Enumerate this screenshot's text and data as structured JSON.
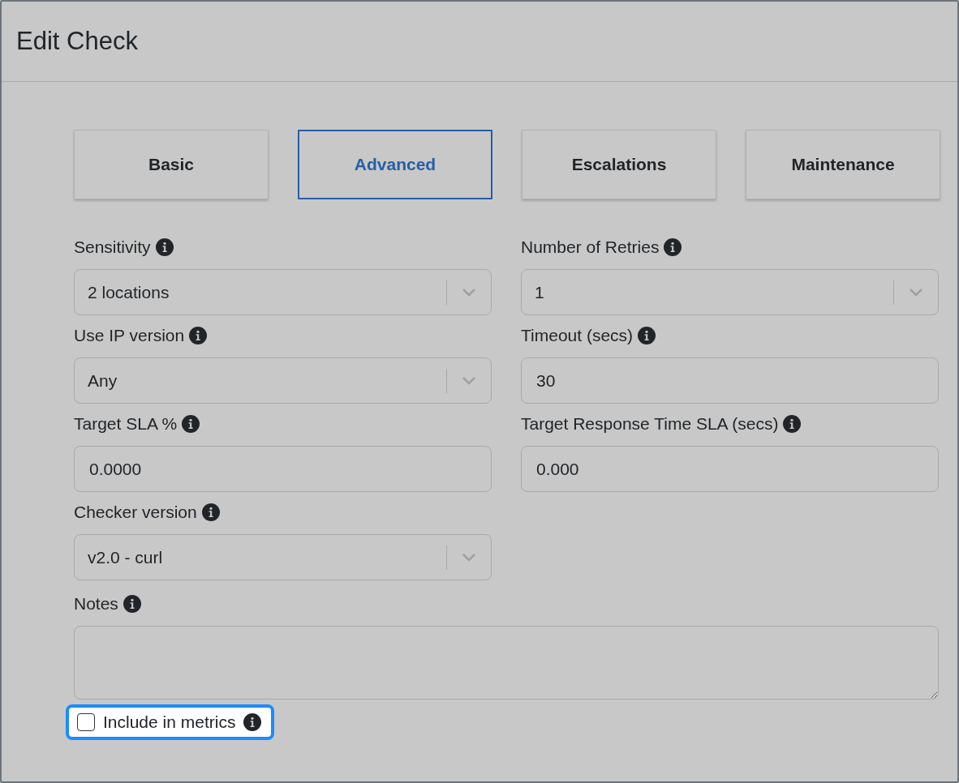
{
  "window": {
    "title": "Edit Check"
  },
  "tabs": [
    {
      "label": "Basic",
      "selected": false
    },
    {
      "label": "Advanced",
      "selected": true
    },
    {
      "label": "Escalations",
      "selected": false
    },
    {
      "label": "Maintenance",
      "selected": false
    }
  ],
  "fields": [
    {
      "label": "Sensitivity",
      "kind": "select",
      "value": "2 locations"
    },
    {
      "label": "Number of Retries",
      "kind": "select",
      "value": "1"
    },
    {
      "label": "Use IP version",
      "kind": "select",
      "value": "Any"
    },
    {
      "label": "Timeout (secs)",
      "kind": "input",
      "value": "30"
    },
    {
      "label": "Target SLA %",
      "kind": "input",
      "value": "0.0000"
    },
    {
      "label": "Target Response Time SLA (secs)",
      "kind": "input",
      "value": "0.000"
    },
    {
      "label": "Checker version",
      "kind": "select",
      "value": "v2.0 - curl"
    }
  ],
  "notes": {
    "label": "Notes"
  },
  "metrics": {
    "label": "Include in metrics",
    "checked": false,
    "focused": true
  }
}
